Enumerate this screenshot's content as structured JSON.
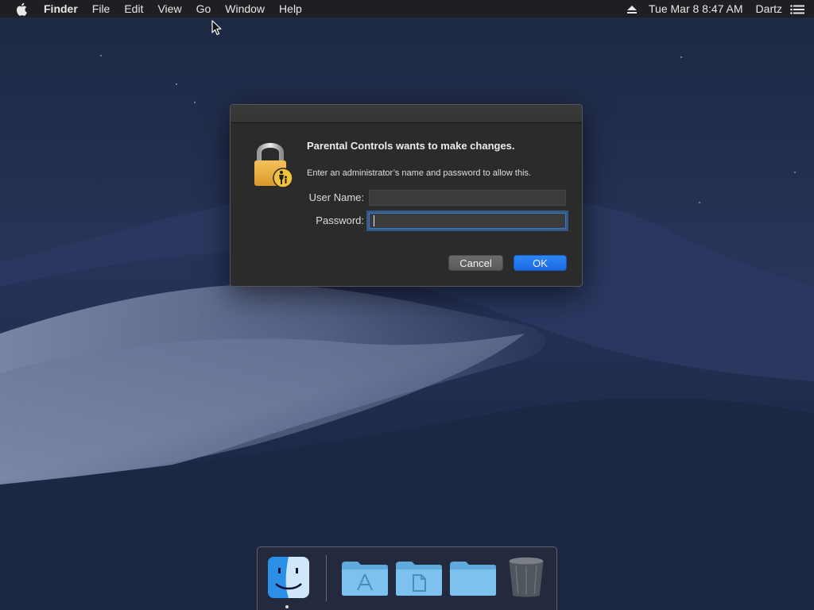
{
  "menubar": {
    "app_name": "Finder",
    "menus": [
      "File",
      "Edit",
      "View",
      "Go",
      "Window",
      "Help"
    ],
    "clock": "Tue Mar 8  8:47 AM",
    "user": "Dartz",
    "icons": [
      "apple-icon",
      "eject-icon",
      "list-icon"
    ]
  },
  "dialog": {
    "title": "Parental Controls wants to make changes.",
    "message": "Enter an administrator’s name and password to allow this.",
    "user_label": "User Name:",
    "user_value": "",
    "password_label": "Password:",
    "password_value": "",
    "cancel_label": "Cancel",
    "ok_label": "OK",
    "icon": "lock-icon",
    "accent_color": "#1a6ae0"
  },
  "dock": {
    "items": [
      "finder-icon",
      "applications-folder-icon",
      "documents-folder-icon",
      "downloads-folder-icon",
      "trash-icon"
    ]
  }
}
